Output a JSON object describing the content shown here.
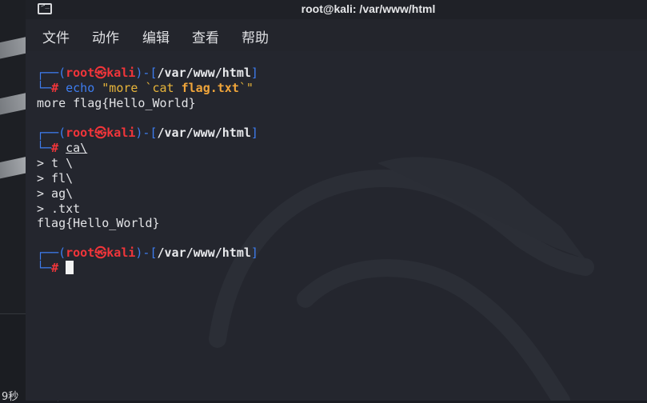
{
  "window": {
    "title": "root@kali: /var/www/html"
  },
  "menu": [
    "文件",
    "动作",
    "编辑",
    "查看",
    "帮助"
  ],
  "prompt": {
    "open": "┌──(",
    "user": "root",
    "skull": "㉿",
    "host": "kali",
    "mid": ")-[",
    "path": "/var/www/html",
    "close": "]",
    "second": "└─",
    "hash": "#"
  },
  "session": [
    {
      "cmd_name": "echo",
      "cmd_rest_pre": "\"more `cat ",
      "cmd_bold": "flag.txt",
      "cmd_rest_post": "`\"",
      "output": [
        "more flag{Hello_World}"
      ]
    },
    {
      "cmd": "ca\\",
      "output": [
        "> t \\",
        "> fl\\",
        "> ag\\",
        "> .txt",
        "flag{Hello_World}"
      ]
    }
  ],
  "desktop": {
    "partial_text": "9秒"
  },
  "colors": {
    "background": "#24262e",
    "prompt_blue": "#3e7df0",
    "prompt_red": "#f0353a",
    "string_yellow": "#e8b53a"
  }
}
